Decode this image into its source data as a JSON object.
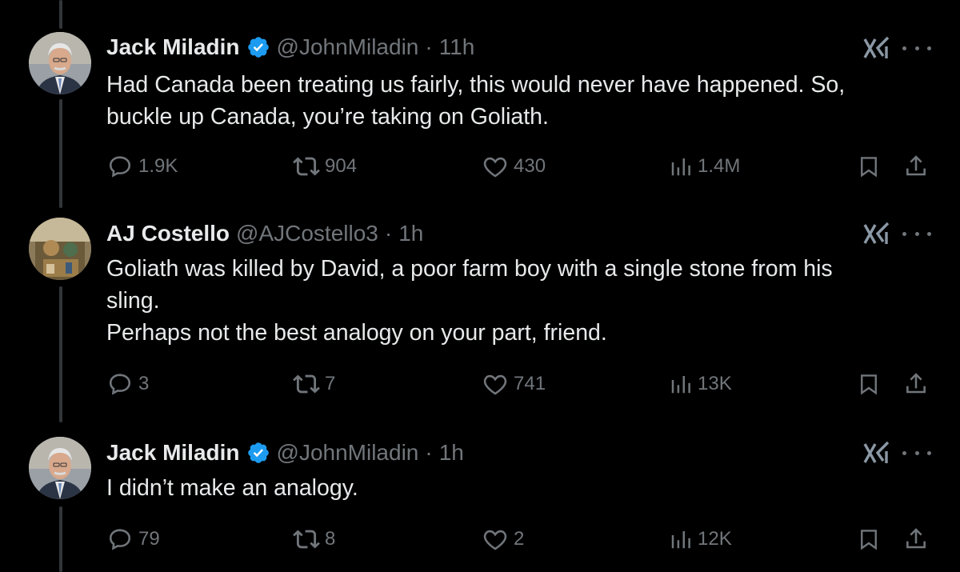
{
  "tweets": [
    {
      "author": "Jack Miladin",
      "handle": "@JohnMiladin",
      "separator": "·",
      "time": "11h",
      "verified": true,
      "text_lines": [
        "Had Canada been treating us fairly, this would never have happened. So,",
        "buckle up Canada, you’re taking on Goliath."
      ],
      "replies": "1.9K",
      "reposts": "904",
      "likes": "430",
      "views": "1.4M"
    },
    {
      "author": "AJ Costello",
      "handle": "@AJCostello3",
      "separator": "·",
      "time": "1h",
      "verified": false,
      "text_lines": [
        "Goliath was killed by David, a poor farm boy with a single stone from his",
        "sling.",
        "Perhaps not the best analogy on your part, friend."
      ],
      "replies": "3",
      "reposts": "7",
      "likes": "741",
      "views": "13K"
    },
    {
      "author": "Jack Miladin",
      "handle": "@JohnMiladin",
      "separator": "·",
      "time": "1h",
      "verified": true,
      "text_lines": [
        "I didn’t make an analogy."
      ],
      "replies": "79",
      "reposts": "8",
      "likes": "2",
      "views": "12K"
    }
  ],
  "icons": {
    "reply": "speech-bubble-icon",
    "repost": "repost-arrows-icon",
    "like": "heart-icon",
    "views": "bar-chart-icon",
    "bookmark": "bookmark-icon",
    "share": "share-upload-icon",
    "grok": "grok-icon",
    "more": "more-dots-icon",
    "verified": "verified-badge-icon"
  },
  "colors": {
    "background": "#000000",
    "text": "#e7e9ea",
    "muted": "#71767b",
    "verified": "#1d9bf0"
  }
}
